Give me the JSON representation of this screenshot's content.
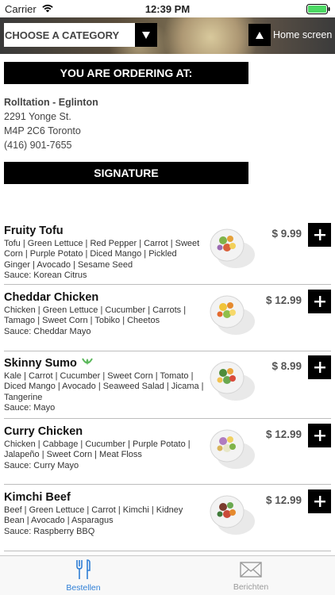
{
  "status_bar": {
    "carrier": "Carrier",
    "time": "12:39 PM"
  },
  "header": {
    "category_placeholder": "CHOOSE A CATEGORY",
    "home_label": "Home screen"
  },
  "ordering": {
    "heading": "YOU ARE ORDERING AT:",
    "location_name": "Rolltation - Eglinton",
    "address_line1": "2291 Yonge St.",
    "address_line2": "M4P 2C6 Toronto",
    "phone": "(416) 901-7655"
  },
  "section_title": "SIGNATURE",
  "items": [
    {
      "name": "Fruity Tofu",
      "description": "Tofu | Green Lettuce | Red Pepper | Carrot | Sweet Corn | Purple Potato | Diced Mango | Pickled Ginger | Avocado | Sesame Seed",
      "sauce": "Sauce: Korean Citrus",
      "price": "$ 9.99",
      "vegan": false
    },
    {
      "name": "Cheddar Chicken",
      "description": "Chicken | Green Lettuce | Cucumber | Carrots | Tamago | Sweet Corn | Tobiko | Cheetos",
      "sauce": "Sauce: Cheddar Mayo",
      "price": "$ 12.99",
      "vegan": false
    },
    {
      "name": "Skinny Sumo",
      "description": "Kale | Carrot | Cucumber | Sweet Corn | Tomato | Diced Mango | Avocado | Seaweed Salad | Jicama | Tangerine",
      "sauce": "Sauce: Mayo",
      "price": "$ 8.99",
      "vegan": true
    },
    {
      "name": "Curry Chicken",
      "description": "Chicken | Cabbage | Cucumber | Purple Potato | Jalapeño | Sweet Corn | Meat Floss",
      "sauce": "Sauce: Curry Mayo",
      "price": "$ 12.99",
      "vegan": false
    },
    {
      "name": "Kimchi Beef",
      "description": "Beef | Green Lettuce | Carrot | Kimchi | Kidney Bean | Avocado | Asparagus",
      "sauce": "Sauce: Raspberry BBQ",
      "price": "$ 12.99",
      "vegan": false
    }
  ],
  "tabs": [
    {
      "label": "Bestellen",
      "icon": "fork-knife-icon",
      "active": true
    },
    {
      "label": "Berichten",
      "icon": "envelope-icon",
      "active": false
    }
  ],
  "colors": {
    "accent": "#2f7fd6",
    "vegan": "#5cb85c",
    "bar": "#000000"
  }
}
